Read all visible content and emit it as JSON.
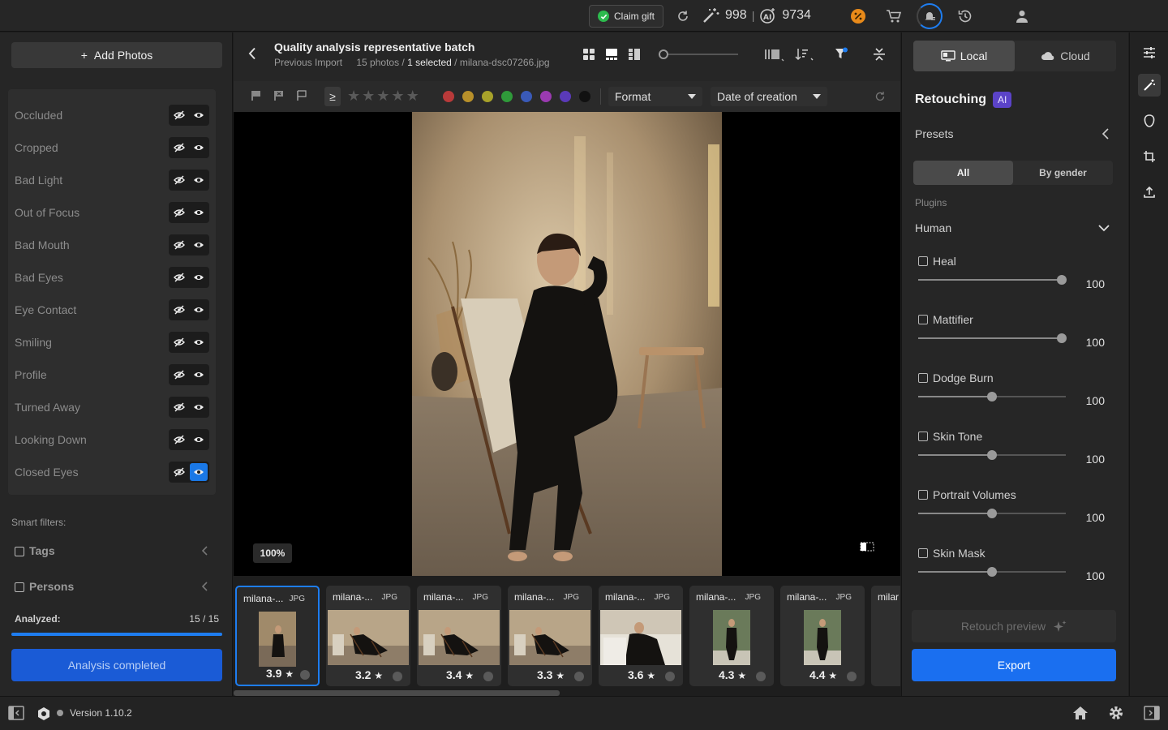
{
  "topbar": {
    "claim_label": "Claim gift",
    "credits_magic": "998",
    "credits_ai": "9734",
    "separator": "|"
  },
  "left": {
    "add_photos": "Add Photos",
    "filters": [
      {
        "label": "Occluded",
        "shown": false
      },
      {
        "label": "Cropped",
        "shown": false
      },
      {
        "label": "Bad Light",
        "shown": false
      },
      {
        "label": "Out of Focus",
        "shown": false
      },
      {
        "label": "Bad Mouth",
        "shown": false
      },
      {
        "label": "Bad Eyes",
        "shown": false
      },
      {
        "label": "Eye Contact",
        "shown": false
      },
      {
        "label": "Smiling",
        "shown": false
      },
      {
        "label": "Profile",
        "shown": false
      },
      {
        "label": "Turned Away",
        "shown": false
      },
      {
        "label": "Looking Down",
        "shown": false
      },
      {
        "label": "Closed Eyes",
        "shown": true
      }
    ],
    "smart_filters_label": "Smart filters:",
    "tags_label": "Tags",
    "persons_label": "Persons",
    "analyzed_label": "Analyzed:",
    "analyzed_value": "15 / 15",
    "analyzed_fraction": 1.0,
    "analysis_button": "Analysis completed"
  },
  "center": {
    "title": "Quality analysis representative batch",
    "previous": "Previous Import",
    "photo_count": "15 photos /",
    "selected": "1 selected",
    "filename": "/ milana-dsc07266.jpg",
    "ge_symbol": "≥",
    "format_label": "Format",
    "date_label": "Date of creation",
    "color_labels": [
      "#b83a3a",
      "#b8902a",
      "#a8a22a",
      "#2f9a3a",
      "#3a5ab8",
      "#9a3ab0",
      "#5a3ab8",
      "#111111"
    ],
    "zoom": "100%",
    "thumbnails": [
      {
        "name": "milana-...",
        "format": "JPG",
        "score": "3.9",
        "selected": true
      },
      {
        "name": "milana-...",
        "format": "JPG",
        "score": "3.2",
        "selected": false
      },
      {
        "name": "milana-...",
        "format": "JPG",
        "score": "3.4",
        "selected": false
      },
      {
        "name": "milana-...",
        "format": "JPG",
        "score": "3.3",
        "selected": false
      },
      {
        "name": "milana-...",
        "format": "JPG",
        "score": "3.6",
        "selected": false
      },
      {
        "name": "milana-...",
        "format": "JPG",
        "score": "4.3",
        "selected": false
      },
      {
        "name": "milana-...",
        "format": "JPG",
        "score": "4.4",
        "selected": false
      },
      {
        "name": "milar",
        "format": "",
        "score": "",
        "selected": false
      }
    ]
  },
  "right": {
    "local_label": "Local",
    "cloud_label": "Cloud",
    "retouching_label": "Retouching",
    "ai_badge": "AI",
    "presets_label": "Presets",
    "all_label": "All",
    "by_gender_label": "By gender",
    "plugins_label": "Plugins",
    "human_label": "Human",
    "plugins": [
      {
        "name": "Heal",
        "value": "100",
        "level": 0.97
      },
      {
        "name": "Mattifier",
        "value": "100",
        "level": 0.97
      },
      {
        "name": "Dodge Burn",
        "value": "100",
        "level": 0.5
      },
      {
        "name": "Skin Tone",
        "value": "100",
        "level": 0.5
      },
      {
        "name": "Portrait Volumes",
        "value": "100",
        "level": 0.5
      },
      {
        "name": "Skin Mask",
        "value": "100",
        "level": 0.5
      }
    ],
    "retouch_preview": "Retouch preview",
    "export": "Export"
  },
  "bottom": {
    "version": "Version 1.10.2"
  }
}
